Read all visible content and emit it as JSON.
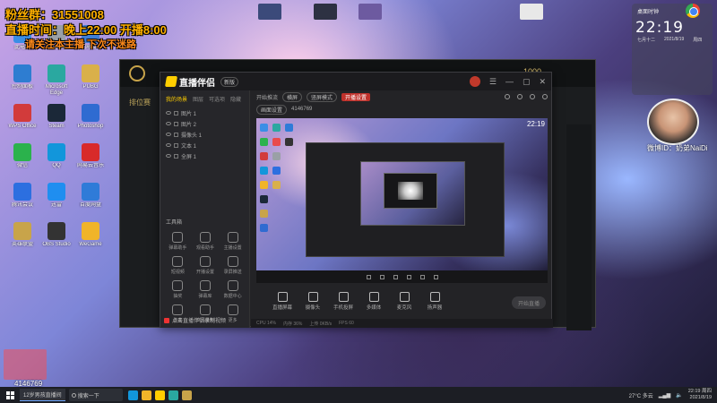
{
  "overlay": {
    "line1": "粉丝群：31551008",
    "line2": "直播时间：晚上22:00 开播8:00",
    "line3": "请关注本主播 下次不迷路"
  },
  "desktop_icons": [
    {
      "label": "此电脑",
      "color": "#3a8ee6"
    },
    {
      "label": "回收站",
      "color": "#9aa0a6"
    },
    {
      "label": "网络",
      "color": "#3f7fd6"
    },
    {
      "label": "控制面板",
      "color": "#2e7dd1"
    },
    {
      "label": "Microsoft Edge",
      "color": "#2aa8a0"
    },
    {
      "label": "PUBG",
      "color": "#d9b04a"
    },
    {
      "label": "WPS Office",
      "color": "#d23b3b"
    },
    {
      "label": "Steam",
      "color": "#1b2838"
    },
    {
      "label": "Photoshop",
      "color": "#2f6bd1"
    },
    {
      "label": "微信",
      "color": "#2bb24c"
    },
    {
      "label": "QQ",
      "color": "#1296db"
    },
    {
      "label": "网易云音乐",
      "color": "#d82a2a"
    },
    {
      "label": "腾讯会议",
      "color": "#2c6fe0"
    },
    {
      "label": "迅雷",
      "color": "#1f8ef0"
    },
    {
      "label": "百度网盘",
      "color": "#2f7bd8"
    },
    {
      "label": "英雄联盟",
      "color": "#c8a44a"
    },
    {
      "label": "OBS Studio",
      "color": "#333"
    },
    {
      "label": "WeGame",
      "color": "#f0b429"
    }
  ],
  "lol_client": {
    "coins": "1000",
    "sub_label": "排位赛"
  },
  "app": {
    "name": "直播伴侣",
    "version": "新版",
    "tabs": [
      "我的场景",
      "图层",
      "可选项",
      "隐藏"
    ],
    "layers": [
      "图片 1",
      "图片 2",
      "摄像头 1",
      "文本 1",
      "全屏 1"
    ],
    "tools_title": "工具箱",
    "tools": [
      "弹幕助手",
      "观看助手",
      "主播设置",
      "短视频",
      "开播设置",
      "录屏推送",
      "抽奖",
      "弹幕库",
      "数据中心",
      "连麦",
      "高清录制",
      "更多"
    ],
    "recorder_note": "点击直播伴侣录制视频",
    "ctrl": {
      "label1": "开始推流",
      "pill1": "横屏",
      "pill2": "竖屏模式",
      "red": "开播设置",
      "line2a": "画面设置",
      "line2b": "4146769"
    },
    "bottom_buttons": [
      "直播屏幕",
      "摄像头",
      "手机投屏",
      "多媒体",
      "麦克风",
      "扬声器"
    ],
    "start_button": "开始直播",
    "status": [
      "CPU 14%",
      "内存 36%",
      "上传 0KB/s",
      "FPS 60"
    ]
  },
  "widget": {
    "title": "桌面时钟",
    "time": "22:19",
    "date1": "七月十二",
    "date2": "2021/8/19",
    "date3": "周四"
  },
  "camera_label": "微博ID：奶弟NaiDi",
  "bottom_id": "4146769",
  "taskbar": {
    "search": "搜索一下",
    "window_item": "12岁男孩直播间",
    "weather": "27°C 多云",
    "time": "22:19 周四",
    "date": "2021/8/19"
  }
}
